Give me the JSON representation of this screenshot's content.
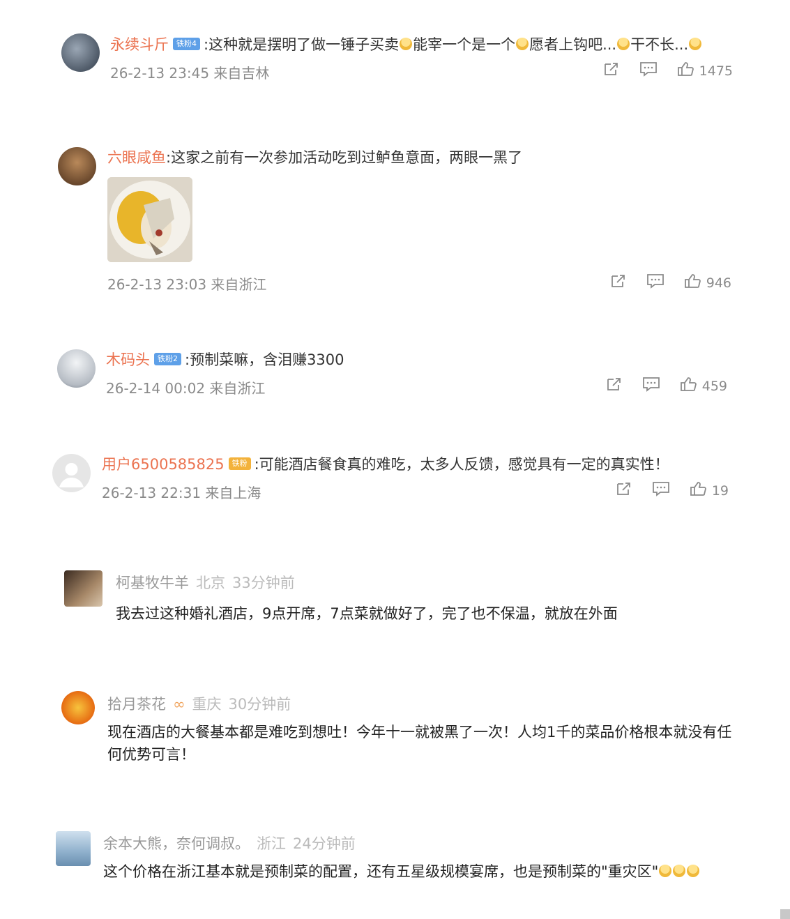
{
  "comments": [
    {
      "username": "永续斗斤",
      "badge": "铁粉4",
      "text": ":这种就是摆明了做一锤子买卖",
      "text2": "能宰一个是一个",
      "text3": "愿者上钩吧...",
      "text4": "干不长...",
      "time": "26-2-13 23:45",
      "location": "来自吉林",
      "likes": "1475"
    },
    {
      "username": "六眼咸鱼",
      "text": ":这家之前有一次参加活动吃到过鲈鱼意面，两眼一黑了",
      "time": "26-2-13 23:03",
      "location": "来自浙江",
      "likes": "946"
    },
    {
      "username": "木码头",
      "badge": "铁粉2",
      "text": ":预制菜嘛，含泪赚3300",
      "time": "26-2-14 00:02",
      "location": "来自浙江",
      "likes": "459"
    },
    {
      "username": "用户6500585825",
      "badge": "铁粉",
      "text": ":可能酒店餐食真的难吃，太多人反馈，感觉具有一定的真实性！",
      "time": "26-2-13 22:31",
      "location": "来自上海",
      "likes": "19"
    }
  ],
  "replies": [
    {
      "username": "柯基牧牛羊",
      "place": "北京",
      "time": "33分钟前",
      "text": "我去过这种婚礼酒店，9点开席，7点菜就做好了，完了也不保温，就放在外面"
    },
    {
      "username": "拾月茶花",
      "place": "重庆",
      "time": "30分钟前",
      "text": "现在酒店的大餐基本都是难吃到想吐！今年十一就被黑了一次！人均1千的菜品价格根本就没有任何优势可言！"
    },
    {
      "username": "余本大熊，奈何调叔。",
      "place": "浙江",
      "time": "24分钟前",
      "text": "这个价格在浙江基本就是预制菜的配置，还有五星级规模宴席，也是预制菜的\"重灾区\""
    }
  ],
  "colors": {
    "username": "#eb7350",
    "meta": "#8a8a8a",
    "badge_blue": "#5ea0e8",
    "badge_gold": "#f3b23b"
  },
  "icons": [
    "share-icon",
    "comment-icon",
    "like-icon",
    "emoji-icon"
  ]
}
